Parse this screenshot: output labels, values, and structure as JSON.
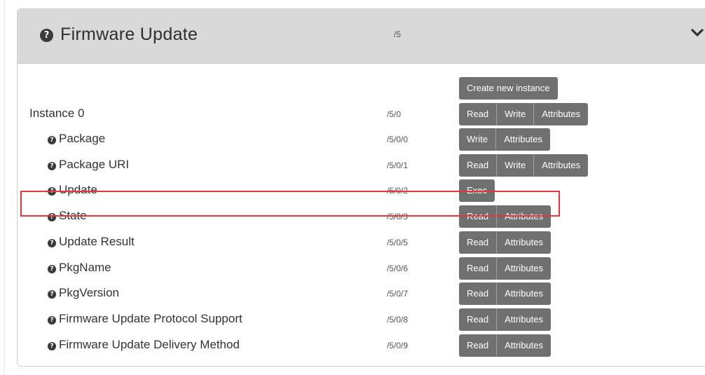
{
  "panel": {
    "title": "Firmware Update",
    "path": "/5",
    "create_label": "Create new instance",
    "icon": "question-circle-icon",
    "collapse_icon": "chevron-down-icon"
  },
  "instance": {
    "label": "Instance 0",
    "path": "/5/0",
    "buttons": [
      "Read",
      "Write",
      "Attributes"
    ]
  },
  "resources": [
    {
      "label": "Package",
      "path": "/5/0/0",
      "buttons": [
        "Write",
        "Attributes"
      ]
    },
    {
      "label": "Package URI",
      "path": "/5/0/1",
      "buttons": [
        "Read",
        "Write",
        "Attributes"
      ]
    },
    {
      "label": "Update",
      "path": "/5/0/2",
      "buttons": [
        "Exec"
      ]
    },
    {
      "label": "State",
      "path": "/5/0/3",
      "buttons": [
        "Read",
        "Attributes"
      ],
      "highlighted": true
    },
    {
      "label": "Update Result",
      "path": "/5/0/5",
      "buttons": [
        "Read",
        "Attributes"
      ]
    },
    {
      "label": "PkgName",
      "path": "/5/0/6",
      "buttons": [
        "Read",
        "Attributes"
      ]
    },
    {
      "label": "PkgVersion",
      "path": "/5/0/7",
      "buttons": [
        "Read",
        "Attributes"
      ]
    },
    {
      "label": "Firmware Update Protocol Support",
      "path": "/5/0/8",
      "buttons": [
        "Read",
        "Attributes"
      ]
    },
    {
      "label": "Firmware Update Delivery Method",
      "path": "/5/0/9",
      "buttons": [
        "Read",
        "Attributes"
      ]
    }
  ],
  "colors": {
    "header_bg": "#d9d9d9",
    "button_bg": "#707070",
    "highlight": "#e0383e"
  }
}
